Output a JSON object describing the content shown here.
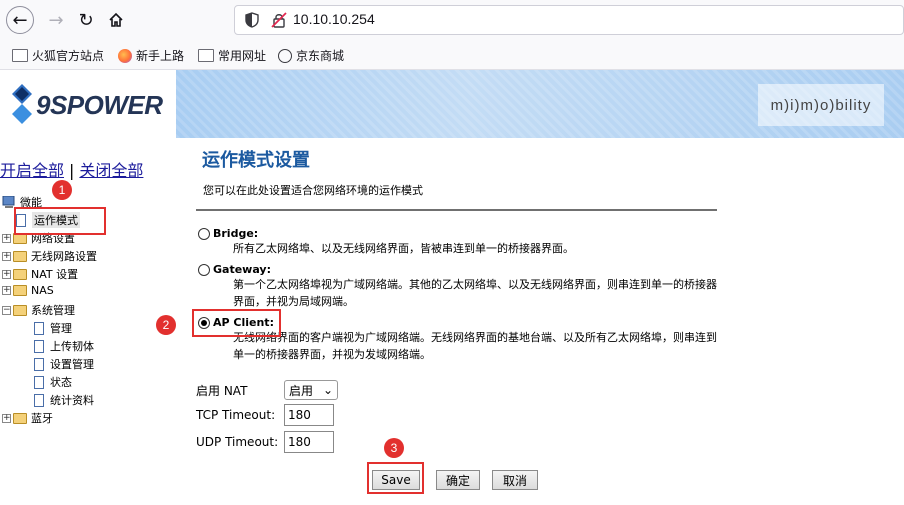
{
  "browser": {
    "url": "10.10.10.254",
    "bookmarks": [
      "火狐官方站点",
      "新手上路",
      "常用网址",
      "京东商城"
    ]
  },
  "header": {
    "logo_text": "9SPOWER",
    "partner_logo": "m)i)m)o)bility"
  },
  "sidebar": {
    "open_all": "开启全部",
    "separator": "|",
    "close_all": "关闭全部",
    "root": "微能",
    "items": [
      {
        "label": "运作模式",
        "type": "doc",
        "selected": true
      },
      {
        "label": "网络设置",
        "type": "folder"
      },
      {
        "label": "无线网路设置",
        "type": "folder"
      },
      {
        "label": "NAT 设置",
        "type": "folder"
      },
      {
        "label": "NAS",
        "type": "folder"
      },
      {
        "label": "系统管理",
        "type": "folder",
        "expanded": true
      },
      {
        "label": "管理",
        "type": "doc"
      },
      {
        "label": "上传韧体",
        "type": "doc"
      },
      {
        "label": "设置管理",
        "type": "doc"
      },
      {
        "label": "状态",
        "type": "doc"
      },
      {
        "label": "统计资料",
        "type": "doc"
      },
      {
        "label": "蓝牙",
        "type": "folder"
      }
    ]
  },
  "main": {
    "title": "运作模式设置",
    "description": "您可以在此处设置适合您网络环境的运作模式",
    "options": [
      {
        "label": "Bridge:",
        "checked": false,
        "text": "所有乙太网络埠、以及无线网络界面，皆被串连到单一的桥接器界面。"
      },
      {
        "label": "Gateway:",
        "checked": false,
        "text": "第一个乙太网络埠视为广域网络端。其他的乙太网络埠、以及无线网络界面，则串连到单一的桥接器界面，并视为局域网端。"
      },
      {
        "label": "AP Client:",
        "checked": true,
        "text": "无线网络界面的客户端视为广域网络端。无线网络界面的基地台端、以及所有乙太网络埠，则串连到单一的桥接器界面，并视为发域网络端。"
      }
    ],
    "nat_label": "启用 NAT",
    "nat_value": "启用",
    "tcp_label": "TCP Timeout:",
    "tcp_value": "180",
    "udp_label": "UDP Timeout:",
    "udp_value": "180",
    "save": "Save",
    "confirm": "确定",
    "cancel": "取消"
  },
  "annotations": [
    "1",
    "2",
    "3"
  ],
  "colors": {
    "accent": "#1c5aa0",
    "annotation": "#e2302e",
    "link": "#1c1c9c"
  }
}
